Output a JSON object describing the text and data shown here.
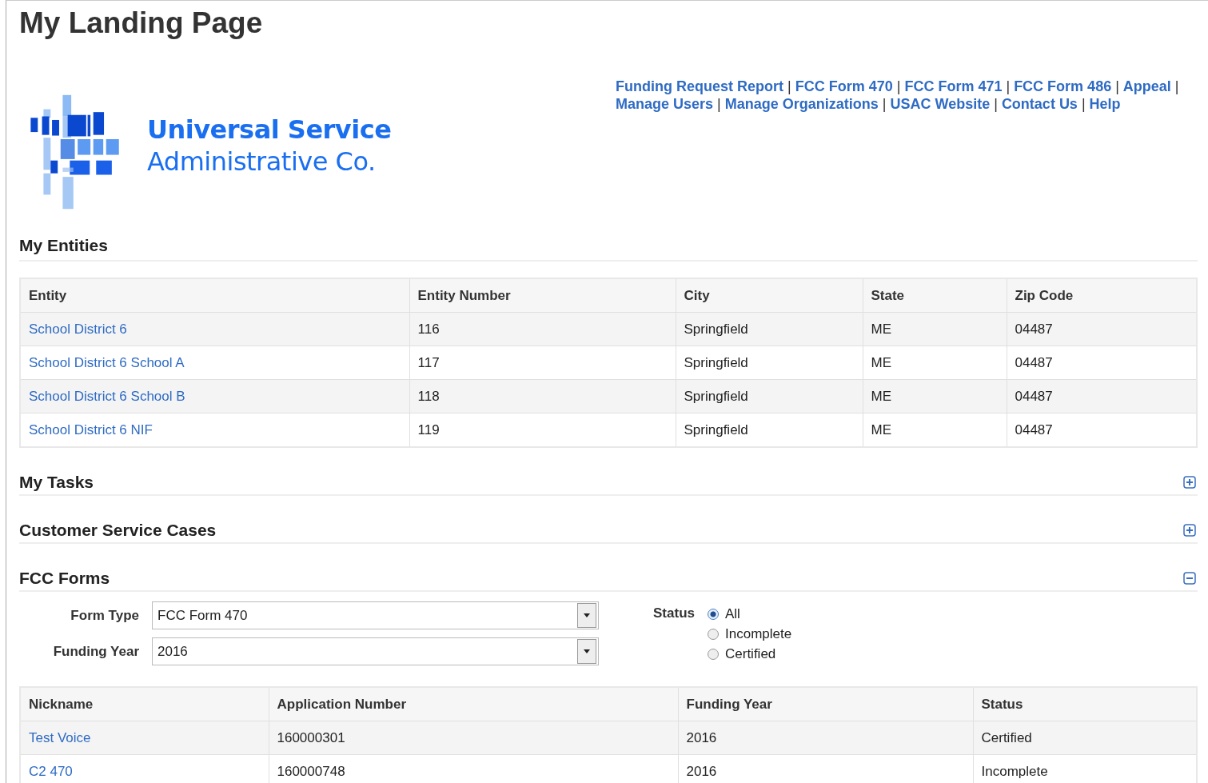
{
  "page_title": "My Landing Page",
  "logo": {
    "line_1": "Universal Service",
    "line_2": "Administrative Co."
  },
  "nav_links": {
    "separator": "|",
    "lines": [
      [
        {
          "label": "Funding Request Report"
        },
        {
          "label": "FCC Form 470"
        },
        {
          "label": "FCC Form 471"
        },
        {
          "label": "FCC Form 486"
        },
        {
          "label": "Appeal"
        }
      ],
      [
        {
          "label": "Manage Users"
        },
        {
          "label": "Manage Organizations"
        },
        {
          "label": "USAC Website"
        },
        {
          "label": "Contact Us"
        },
        {
          "label": "Help"
        }
      ]
    ]
  },
  "entities": {
    "title": "My Entities",
    "table": {
      "columns": [
        "Entity",
        "Entity Number",
        "City",
        "State",
        "Zip Code"
      ],
      "rows": [
        [
          "School District 6",
          "116",
          "Springfield",
          "ME",
          "04487"
        ],
        [
          "School District 6 School A",
          "117",
          "Springfield",
          "ME",
          "04487"
        ],
        [
          "School District 6 School B",
          "118",
          "Springfield",
          "ME",
          "04487"
        ],
        [
          "School District 6 NIF",
          "119",
          "Springfield",
          "ME",
          "04487"
        ]
      ]
    }
  },
  "collapsed_sections": [
    {
      "title": "My Tasks",
      "expanded": false
    },
    {
      "title": "Customer Service Cases",
      "expanded": false
    }
  ],
  "fcc_forms": {
    "title": "FCC Forms",
    "expanded": true,
    "filters": {
      "form_type_label": "Form Type",
      "form_type": "FCC Form 470",
      "funding_year_label": "Funding Year",
      "funding_year": "2016",
      "status_label": "Status",
      "status_options": [
        {
          "label": "All",
          "selected": true
        },
        {
          "label": "Incomplete",
          "selected": false
        },
        {
          "label": "Certified",
          "selected": false
        }
      ]
    },
    "table": {
      "columns": [
        "Nickname",
        "Application Number",
        "Funding Year",
        "Status"
      ],
      "rows": [
        [
          "Test Voice",
          "160000301",
          "2016",
          "Certified"
        ],
        [
          "C2 470",
          "160000748",
          "2016",
          "Incomplete"
        ]
      ]
    }
  }
}
